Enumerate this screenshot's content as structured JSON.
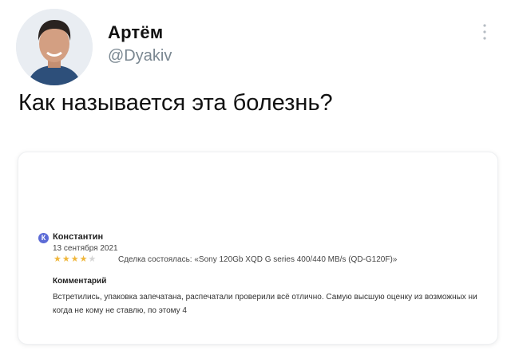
{
  "tweet": {
    "author_name": "Артём",
    "author_handle": "@Dyakiv",
    "text": "Как называется эта болезнь?",
    "avatar_icon": "user-avatar-photo",
    "more_icon": "vertical-dots-icon"
  },
  "review": {
    "reviewer_initial": "К",
    "reviewer_name": "Константин",
    "date": "13 сентября 2021",
    "rating": {
      "filled": 4,
      "total": 5
    },
    "deal_text": "Сделка состоялась: «Sony 120Gb XQD G series 400/440 MB/s (QD-G120F)»",
    "comment_heading": "Комментарий",
    "comment_text": "Встретились, упаковка запечатана, распечатали проверили всё отлично. Самую высшую оценку из возможных ни когда не кому не ставлю, по этому 4"
  },
  "colors": {
    "star_filled": "#f0b73c",
    "star_empty": "#d5d5d5",
    "reviewer_avatar_bg": "#5c6bd6",
    "handle_gray": "#7a8791"
  }
}
